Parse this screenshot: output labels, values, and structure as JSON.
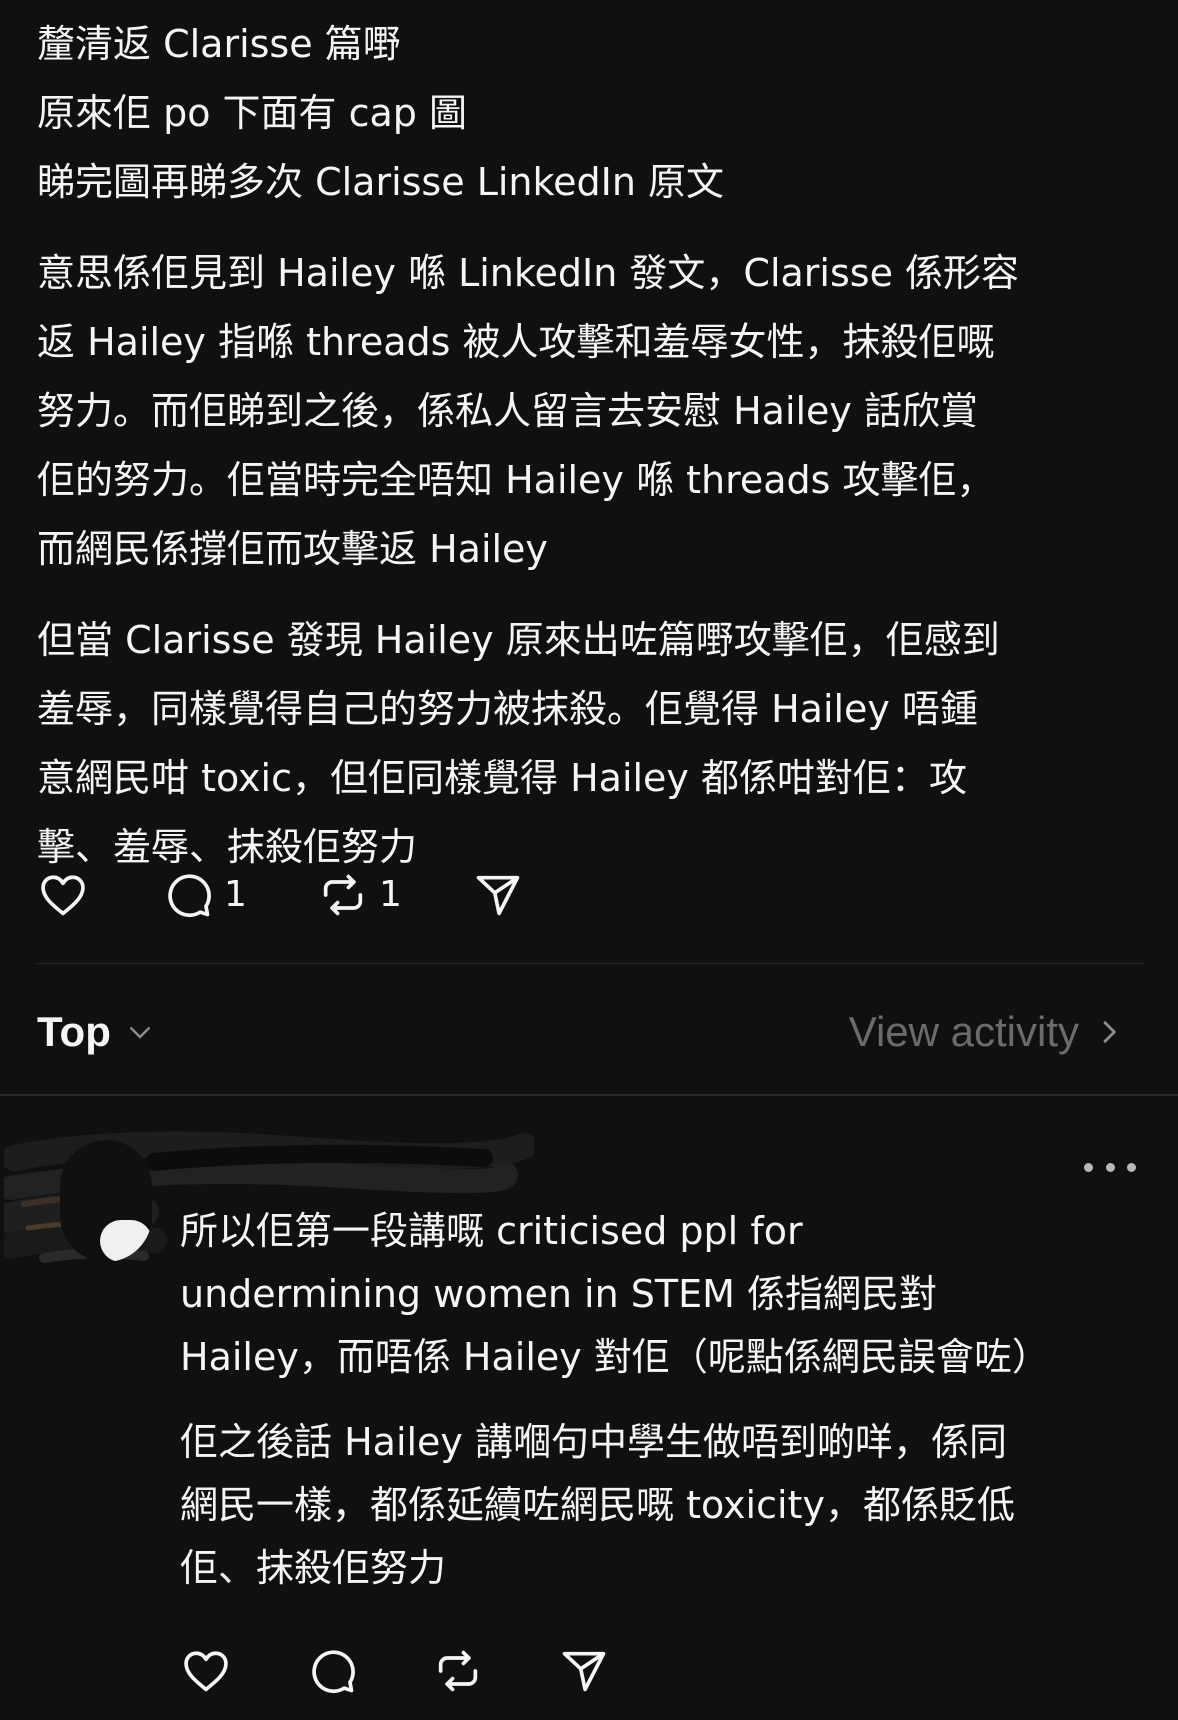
{
  "post": {
    "paragraphs": [
      [
        "釐清返 Clarisse 篇嘢",
        "原來佢 po 下面有 cap 圖",
        "睇完圖再睇多次 Clarisse LinkedIn 原文"
      ],
      [
        "意思係佢見到 Hailey 喺 LinkedIn 發文，Clarisse 係形容",
        "返 Hailey 指喺 threads 被人攻擊和羞辱女性，抹殺佢嘅",
        "努力。而佢睇到之後，係私人留言去安慰 Hailey 話欣賞",
        "佢的努力。佢當時完全唔知 Hailey 喺 threads 攻擊佢，",
        "而網民係撐佢而攻擊返 Hailey"
      ],
      [
        "但當 Clarisse 發現 Hailey 原來出咗篇嘢攻擊佢，佢感到",
        "羞辱，同樣覺得自己的努力被抹殺。佢覺得 Hailey 唔鍾",
        "意網民咁 toxic，但佢同樣覺得 Hailey 都係咁對佢：攻",
        "擊、羞辱、抹殺佢努力"
      ]
    ],
    "actions": {
      "like_icon": "heart-icon",
      "comment_icon": "speech-bubble-icon",
      "comment_count": "1",
      "repost_icon": "repost-arrows-icon",
      "repost_count": "1",
      "share_icon": "paper-plane-icon"
    }
  },
  "sort_bar": {
    "sort_label": "Top",
    "sort_icon": "chevron-down-icon",
    "view_activity_label": "View activity",
    "view_activity_icon": "chevron-right-icon"
  },
  "reply": {
    "author": "",
    "more_icon": "more-dots-icon",
    "paragraphs": [
      [
        "所以佢第一段講嘅 criticised ppl for",
        "undermining women in STEM 係指網民對",
        " Hailey，而唔係 Hailey 對佢（呢點係網民誤會咗）"
      ],
      [
        "佢之後話 Hailey 講嗰句中學生做唔到啲咩，係同",
        "網民一樣，都係延續咗網民嘅 toxicity，都係貶低",
        "佢、抹殺佢努力"
      ]
    ],
    "actions": {
      "like_icon": "heart-icon",
      "comment_icon": "speech-bubble-icon",
      "repost_icon": "repost-arrows-icon",
      "share_icon": "paper-plane-icon"
    }
  },
  "colors": {
    "background": "#101010",
    "text": "#f3f5f7",
    "muted": "#6b6b6b",
    "divider": "#2b2b2b"
  }
}
